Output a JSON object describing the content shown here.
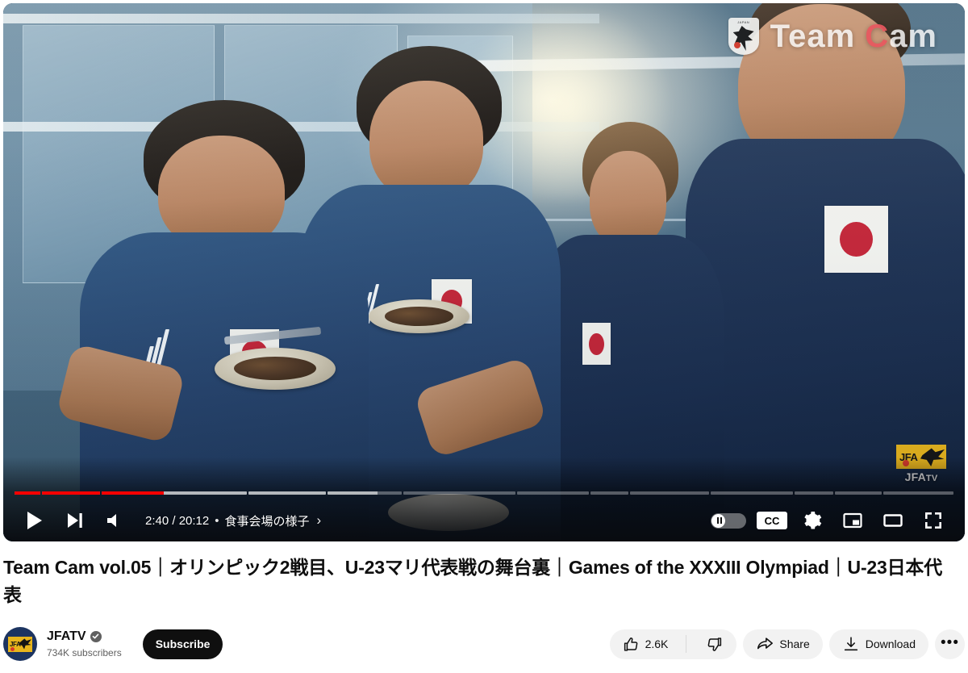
{
  "video": {
    "watermark_brand": "Team Cam",
    "watermark_brand_first": "Team ",
    "watermark_brand_accent": "C",
    "watermark_brand_rest": "am",
    "crest_label": "JAPAN",
    "corner_logo_letters": "JFA",
    "corner_logo_label": "JFATV",
    "corner_logo_label_main": "JFA",
    "corner_logo_label_tv": "TV"
  },
  "player": {
    "play_button": "play-icon",
    "next_button": "next-track-icon",
    "volume_button": "volume-icon",
    "current_time": "2:40",
    "duration": "20:12",
    "time_display": "2:40 / 20:12",
    "time_separator": "•",
    "chapter_name": "食事会場の様子",
    "chapter_chevron": "›",
    "autoplay_label": "autoplay-toggle",
    "cc_label": "CC",
    "settings_label": "settings-gear",
    "miniplayer_label": "miniplayer",
    "theater_label": "theater-mode",
    "fullscreen_label": "fullscreen",
    "progress_played_pct": 13.2,
    "accent_color": "#ff0000",
    "chapters": [
      {
        "width_pct": 2.8,
        "played_pct": 100,
        "buffered_pct": 100
      },
      {
        "width_pct": 6.3,
        "played_pct": 100,
        "buffered_pct": 100
      },
      {
        "width_pct": 15.8,
        "played_pct": 43,
        "buffered_pct": 100
      },
      {
        "width_pct": 8.4,
        "played_pct": 0,
        "buffered_pct": 100
      },
      {
        "width_pct": 8.1,
        "played_pct": 0,
        "buffered_pct": 68
      },
      {
        "width_pct": 12.2,
        "played_pct": 0,
        "buffered_pct": 0
      },
      {
        "width_pct": 7.8,
        "played_pct": 0,
        "buffered_pct": 0
      },
      {
        "width_pct": 4.1,
        "played_pct": 0,
        "buffered_pct": 0
      },
      {
        "width_pct": 8.6,
        "played_pct": 0,
        "buffered_pct": 0
      },
      {
        "width_pct": 9.0,
        "played_pct": 0,
        "buffered_pct": 0
      },
      {
        "width_pct": 4.2,
        "played_pct": 0,
        "buffered_pct": 0
      },
      {
        "width_pct": 5.1,
        "played_pct": 0,
        "buffered_pct": 0
      },
      {
        "width_pct": 7.6,
        "played_pct": 0,
        "buffered_pct": 0
      }
    ]
  },
  "title": "Team Cam vol.05｜オリンピック2戦目、U-23マリ代表戦の舞台裏｜Games of the XXXIII Olympiad｜U-23日本代表",
  "channel": {
    "name": "JFATV",
    "verified": true,
    "subscribers": "734K subscribers",
    "subscribe_label": "Subscribe",
    "avatar_letters": "JFA"
  },
  "actions": {
    "like_count": "2.6K",
    "like_icon": "thumbs-up-icon",
    "dislike_icon": "thumbs-down-icon",
    "share_label": "Share",
    "download_label": "Download",
    "more_label": "•••"
  }
}
